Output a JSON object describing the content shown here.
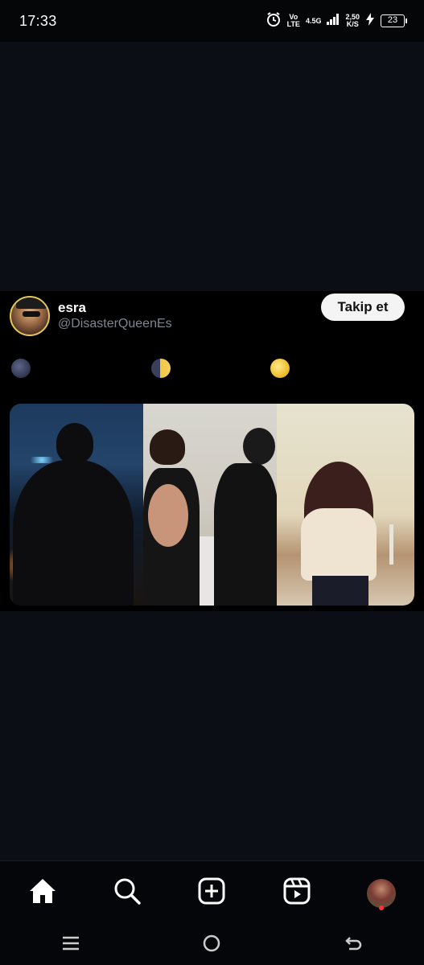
{
  "status_bar": {
    "time": "17:33",
    "volte_top": "Vo",
    "volte_bottom": "LTE",
    "network": "4.5G",
    "speed_value": "2,50",
    "speed_unit": "K/S",
    "battery": "23"
  },
  "post": {
    "display_name": "esra",
    "handle": "@DisasterQueenEs",
    "follow_label": "Takip et",
    "text_emojis": [
      "new-moon",
      "first-quarter-moon",
      "full-moon"
    ]
  },
  "bottom_nav": {
    "items": [
      "home-icon",
      "search-icon",
      "create-icon",
      "reels-icon",
      "profile-avatar"
    ]
  },
  "system_nav": {
    "items": [
      "recents-icon",
      "home-circle-icon",
      "back-icon"
    ]
  },
  "colors": {
    "background": "#0b0e14",
    "post_background": "#000000",
    "follow_button_bg": "#f4f4f4",
    "notification_dot": "#ff3040"
  }
}
